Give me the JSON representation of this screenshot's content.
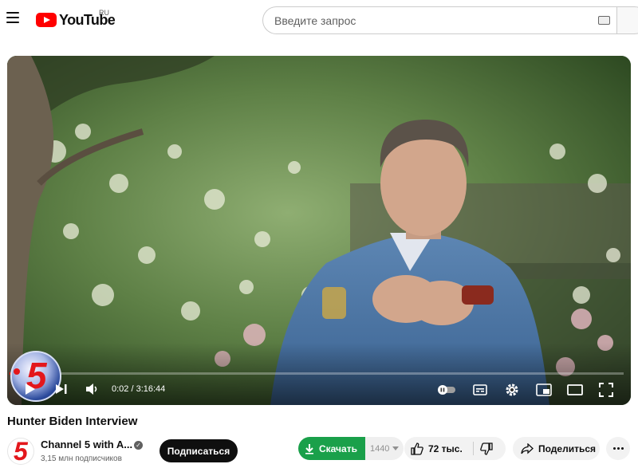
{
  "header": {
    "logo_text": "YouTube",
    "region": "RU",
    "search_placeholder": "Введите запрос"
  },
  "player": {
    "time_display": "0:02 / 3:16:44",
    "progress": 0.0002,
    "overlay_logo_text": "5"
  },
  "video": {
    "title": "Hunter Biden Interview"
  },
  "channel": {
    "name": "Channel 5 with A...",
    "subscribers": "3,15 млн подписчиков",
    "avatar_text": "5"
  },
  "actions": {
    "subscribe": "Подписаться",
    "download": "Скачать",
    "download_quality": "1440",
    "likes": "72 тыс.",
    "share": "Поделиться"
  },
  "colors": {
    "brand_red": "#ff0000",
    "download_green": "#1aa04a",
    "subscribe_bg": "#0f0f0f"
  }
}
